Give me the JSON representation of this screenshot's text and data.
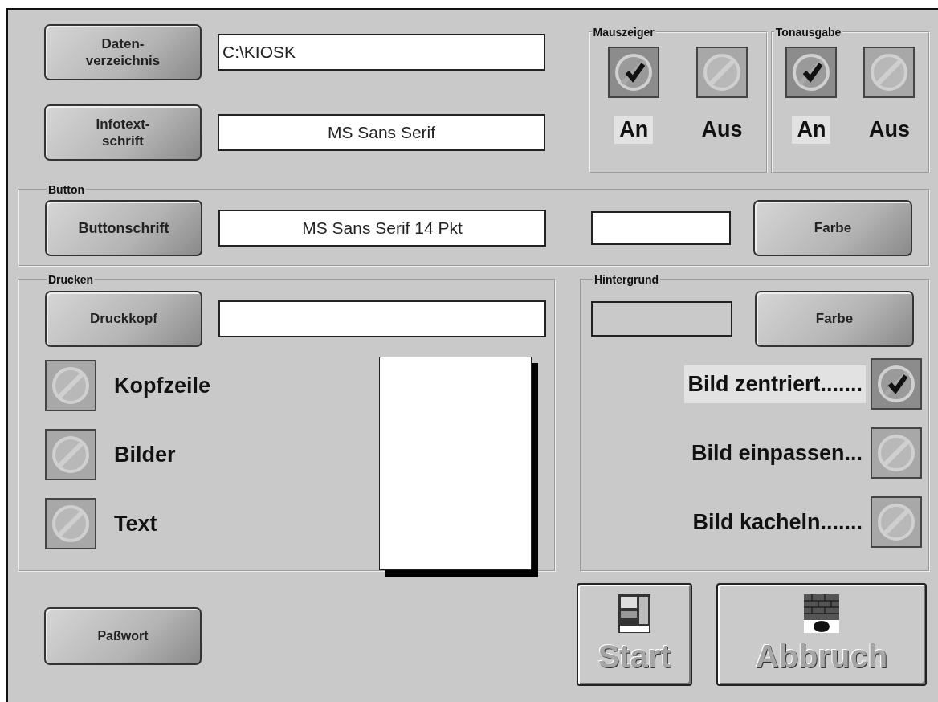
{
  "settings": [
    {
      "button": {
        "lines": [
          "Daten-",
          "verzeichnis"
        ]
      },
      "field": {
        "value": "C:\\KIOSK",
        "kind": "path"
      }
    },
    {
      "button": {
        "lines": [
          "Infotext-",
          "schrift"
        ]
      },
      "field": {
        "value": "MS Sans Serif",
        "kind": "font"
      }
    }
  ],
  "toggle_groups": [
    {
      "title": "Mauszeiger",
      "options": [
        {
          "label": "An",
          "selected": true
        },
        {
          "label": "Aus",
          "selected": false
        }
      ]
    },
    {
      "title": "Tonausgabe",
      "options": [
        {
          "label": "An",
          "selected": true
        },
        {
          "label": "Aus",
          "selected": false
        }
      ]
    }
  ],
  "button_section": {
    "title": "Button",
    "font_button": "Buttonschrift",
    "font_field": "MS Sans Serif 14 Pkt",
    "color_button": "Farbe"
  },
  "print": {
    "title": "Drucken",
    "header_button": "Druckkopf",
    "options": [
      {
        "label": "Kopfzeile",
        "checked": false
      },
      {
        "label": "Bilder",
        "checked": false
      },
      {
        "label": "Text",
        "checked": false
      }
    ]
  },
  "background": {
    "title": "Hintergrund",
    "color_button": "Farbe",
    "options": [
      {
        "label": "Bild zentriert.......",
        "selected": true
      },
      {
        "label": "Bild einpassen...",
        "selected": false
      },
      {
        "label": "Bild kacheln.......",
        "selected": false
      }
    ]
  },
  "password_button": "Paßwort",
  "start_button": "Start",
  "cancel_button": "Abbruch"
}
